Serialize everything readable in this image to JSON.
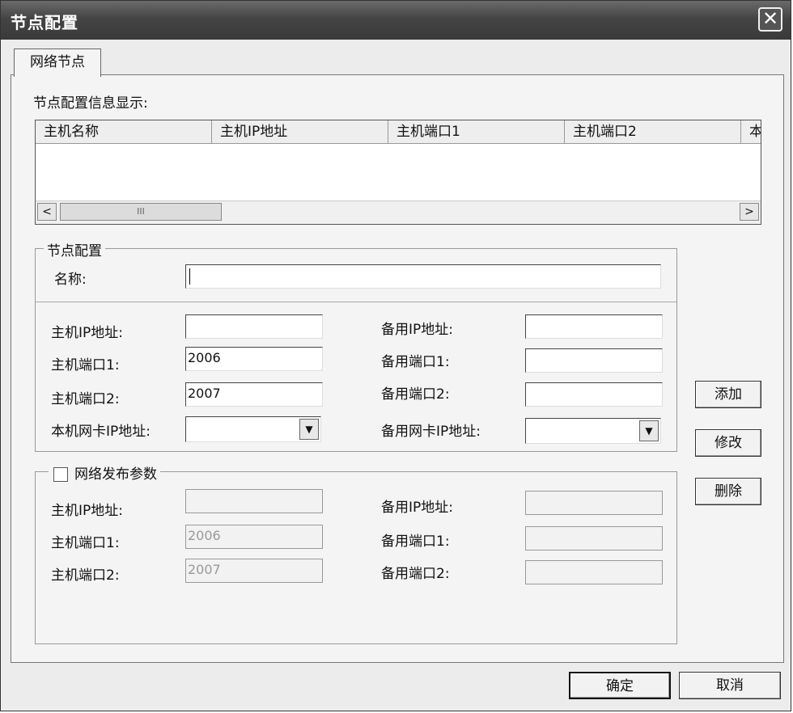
{
  "window": {
    "title": "节点配置",
    "close_icon": "close-icon"
  },
  "tab": {
    "label": "网络节点"
  },
  "info_label": "节点配置信息显示:",
  "list": {
    "columns": [
      "主机名称",
      "主机IP地址",
      "主机端口1",
      "主机端口2",
      "本"
    ],
    "scroll_thumb": "III",
    "left_arrow": "<",
    "right_arrow": ">"
  },
  "node_config": {
    "group_title": "节点配置",
    "name_label": "名称:",
    "name_value": "",
    "host_ip_label": "主机IP地址:",
    "host_ip_value": "",
    "host_port1_label": "主机端口1:",
    "host_port1_value": "2006",
    "host_port2_label": "主机端口2:",
    "host_port2_value": "2007",
    "local_nic_label": "本机网卡IP地址:",
    "local_nic_value": "",
    "backup_ip_label": "备用IP地址:",
    "backup_ip_value": "",
    "backup_port1_label": "备用端口1:",
    "backup_port1_value": "",
    "backup_port2_label": "备用端口2:",
    "backup_port2_value": "",
    "backup_nic_label": "备用网卡IP地址:",
    "backup_nic_value": ""
  },
  "publish": {
    "group_title": "网络发布参数",
    "checked": false,
    "host_ip_label": "主机IP地址:",
    "host_ip_value": "",
    "host_port1_label": "主机端口1:",
    "host_port1_value": "2006",
    "host_port2_label": "主机端口2:",
    "host_port2_value": "2007",
    "backup_ip_label": "备用IP地址:",
    "backup_ip_value": "",
    "backup_port1_label": "备用端口1:",
    "backup_port1_value": "",
    "backup_port2_label": "备用端口2:",
    "backup_port2_value": ""
  },
  "buttons": {
    "add": "添加",
    "modify": "修改",
    "delete": "删除",
    "ok": "确定",
    "cancel": "取消"
  }
}
